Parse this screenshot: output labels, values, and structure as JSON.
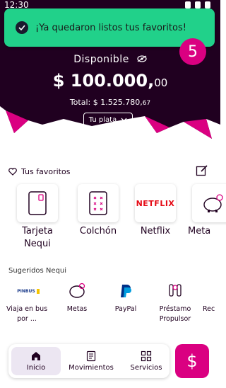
{
  "status_bar": {
    "time": "12:30"
  },
  "toast": {
    "message": "¡Ya quedaron listos tus favoritos!"
  },
  "badge": {
    "count": "5"
  },
  "balance": {
    "available_label": "Disponible",
    "amount": "$ 100.000,",
    "amount_cents": "00",
    "total_label": "Total: $ 1.525.780,",
    "total_cents": "67",
    "pocket_selector": "Tu plata"
  },
  "favorites": {
    "title": "Tus favoritos",
    "items": [
      {
        "label": "Tarjeta Nequi",
        "icon": "card-icon"
      },
      {
        "label": "Colchón",
        "icon": "mattress-icon"
      },
      {
        "label": "Netflix",
        "icon": "netflix-logo",
        "logo_text": "NETFLIX"
      },
      {
        "label": "Meta",
        "icon": "piggy-bank-icon"
      }
    ]
  },
  "suggested": {
    "title": "Sugeridos Nequi",
    "items": [
      {
        "label": "Viaja en bus por ...",
        "icon": "bus-logo",
        "logo_text": "PINBUS"
      },
      {
        "label": "Metas",
        "icon": "piggy-bank-icon"
      },
      {
        "label": "PayPal",
        "icon": "paypal-logo"
      },
      {
        "label": "Préstamo Propulsor",
        "icon": "loan-icon"
      },
      {
        "label": "Rec",
        "icon": "recharge-icon"
      }
    ]
  },
  "bottom_nav": {
    "items": [
      {
        "label": "Inicio",
        "icon": "home-icon",
        "active": true
      },
      {
        "label": "Movimientos",
        "icon": "document-icon",
        "active": false
      },
      {
        "label": "Servicios",
        "icon": "grid-icon",
        "active": false
      }
    ],
    "fab_label": "$"
  },
  "colors": {
    "dark": "#200020",
    "accent": "#da0081",
    "success": "#21d18a"
  }
}
